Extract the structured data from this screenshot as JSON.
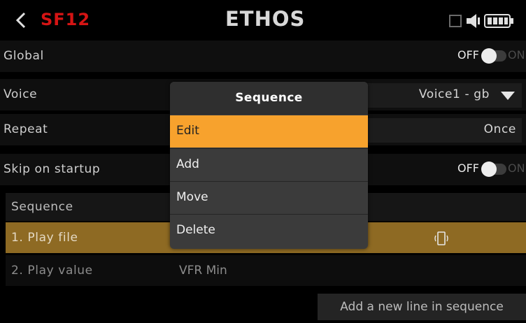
{
  "header": {
    "model_name": "SF12",
    "logo_text": "ETHOS",
    "icons": [
      "back-chevron-icon",
      "sd-card-icon",
      "speaker-icon",
      "battery-icon"
    ],
    "accent_color": "#d51414"
  },
  "settings": {
    "global": {
      "label": "Global",
      "off": "OFF",
      "on": "ON",
      "state": "off"
    },
    "voice": {
      "label": "Voice",
      "value": "Voice1 - gb"
    },
    "repeat": {
      "label": "Repeat",
      "value": "Once"
    },
    "skip_on_startup": {
      "label": "Skip on startup",
      "off": "OFF",
      "on": "ON",
      "state": "off"
    }
  },
  "sequence": {
    "header": "Sequence",
    "lines": [
      {
        "label": "1. Play file",
        "param_icon": "audio-file-icon",
        "selected": true
      },
      {
        "label": "2. Play value",
        "param": "VFR Min",
        "selected": false
      }
    ],
    "add_button": "Add a new line in sequence"
  },
  "dialog": {
    "title": "Sequence",
    "items": [
      {
        "label": "Edit",
        "selected": true
      },
      {
        "label": "Add",
        "selected": false
      },
      {
        "label": "Move",
        "selected": false
      },
      {
        "label": "Delete",
        "selected": false
      }
    ],
    "highlight_color": "#f7a22d"
  }
}
